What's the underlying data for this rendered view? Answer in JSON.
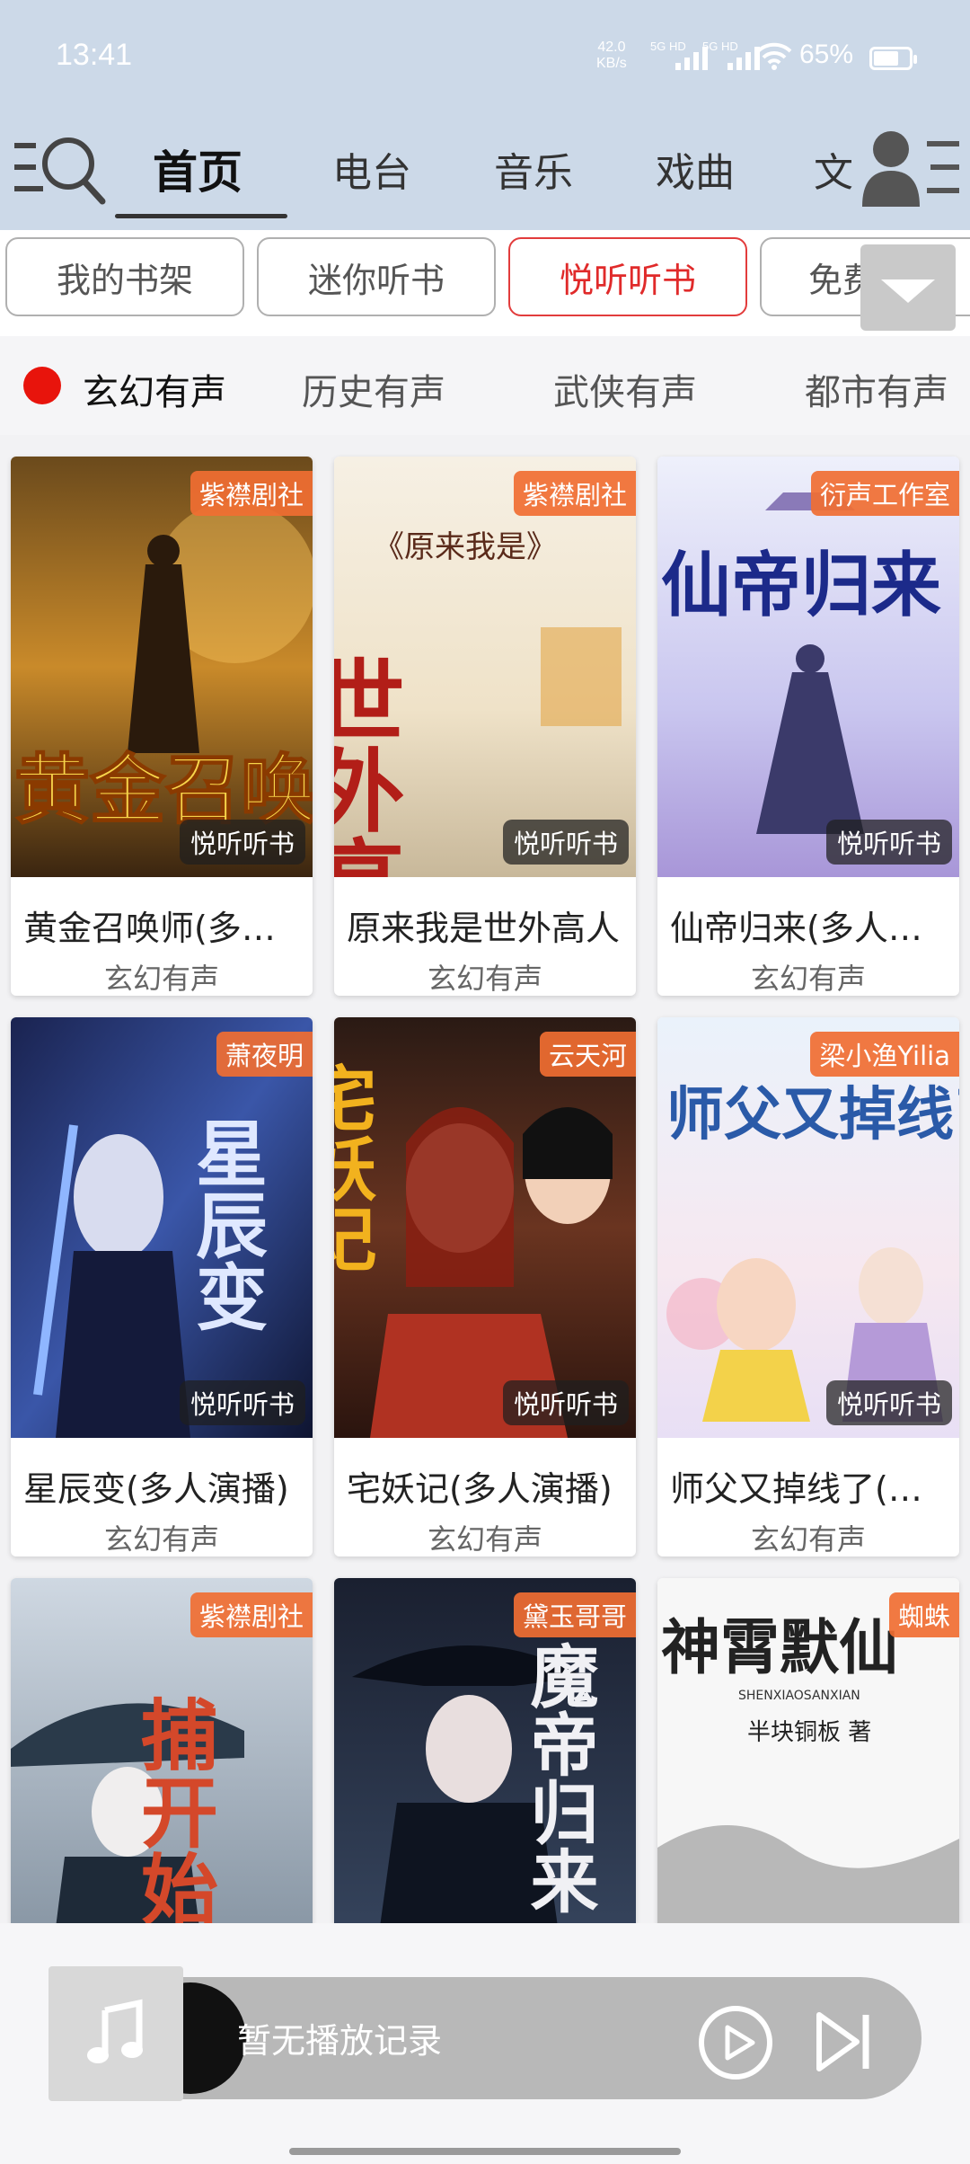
{
  "status_bar": {
    "time": "13:41",
    "net_speed_value": "42.0",
    "net_speed_unit": "KB/s",
    "sim1_label": "5G HD",
    "sim2_label": "5G HD",
    "battery_text": "65%",
    "battery_level": 0.65
  },
  "header": {
    "tabs": [
      {
        "label": "首页",
        "active": true
      },
      {
        "label": "电台"
      },
      {
        "label": "音乐"
      },
      {
        "label": "戏曲"
      },
      {
        "label": "文"
      }
    ]
  },
  "subtabs": [
    "我的书架",
    "迷你听书",
    "悦听听书",
    "免费"
  ],
  "categories": [
    "玄幻有声",
    "历史有声",
    "武侠有声",
    "都市有声"
  ],
  "books": [
    {
      "title": "黄金召唤师(多人演播)",
      "genre": "玄幻有声",
      "publisher": "紫襟剧社",
      "brand": "悦听听书",
      "cover_text": "黄金召唤师"
    },
    {
      "title": "原来我是世外高人",
      "genre": "玄幻有声",
      "publisher": "紫襟剧社",
      "brand": "悦听听书",
      "cover_text": "世外高人",
      "cover_sub": "《原来我是》"
    },
    {
      "title": "仙帝归来(多人演播)",
      "genre": "玄幻有声",
      "publisher": "衍声工作室",
      "brand": "悦听听书",
      "cover_text": "仙帝归来"
    },
    {
      "title": "星辰变(多人演播)",
      "genre": "玄幻有声",
      "publisher": "萧夜明",
      "brand": "悦听听书",
      "cover_text": "星辰变"
    },
    {
      "title": "宅妖记(多人演播)",
      "genre": "玄幻有声",
      "publisher": "云天河",
      "brand": "悦听听书",
      "cover_text": "宅妖记"
    },
    {
      "title": "师父又掉线了(多人演播)",
      "genre": "玄幻有声",
      "publisher": "梁小渔Yilia",
      "brand": "悦听听书",
      "cover_text": "师父又掉线了"
    },
    {
      "title": "",
      "genre": "",
      "publisher": "紫襟剧社",
      "brand": "",
      "cover_text": "捕开始"
    },
    {
      "title": "",
      "genre": "",
      "publisher": "黛玉哥哥",
      "brand": "",
      "cover_text": "魔帝归来"
    },
    {
      "title": "",
      "genre": "",
      "publisher": "蜘蛛",
      "brand": "",
      "cover_text": "神霄默仙",
      "cover_sub": "SHENXIAOSANXIAN",
      "cover_author": "半块铜板 著"
    }
  ],
  "player": {
    "empty_text": "暂无播放记录"
  },
  "colors": {
    "header_bg": "#ccd9e8",
    "accent_red": "#e02a2a",
    "publisher_badge": "#f06e32"
  }
}
